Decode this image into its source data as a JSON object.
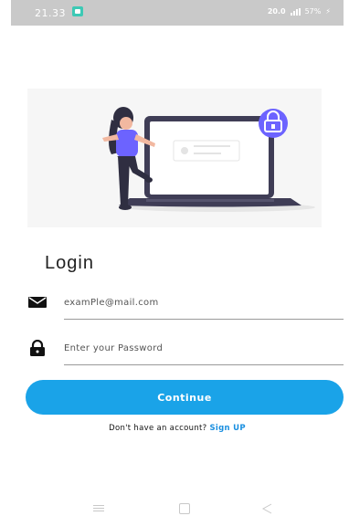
{
  "status_bar": {
    "time": "21.33",
    "network_speed": "20.0",
    "battery": "57%"
  },
  "login": {
    "title": "Login"
  },
  "email_field": {
    "placeholder": "examPle@mail.com",
    "value": "",
    "icon": "envelope-icon"
  },
  "password_field": {
    "placeholder": "Enter your Password",
    "value": "",
    "icon": "lock-icon"
  },
  "continue_button": {
    "label": "Continue"
  },
  "signup": {
    "prompt": "Don't have an account?",
    "link": "Sign UP"
  },
  "nav_bar": {
    "menu_icon": "menu-icon",
    "home_icon": "home-icon",
    "back_icon": "back-icon"
  },
  "colors": {
    "accent": "#1aa3e8",
    "status_bar": "#c9c9c9",
    "illustration_lock": "#6c63ff"
  }
}
